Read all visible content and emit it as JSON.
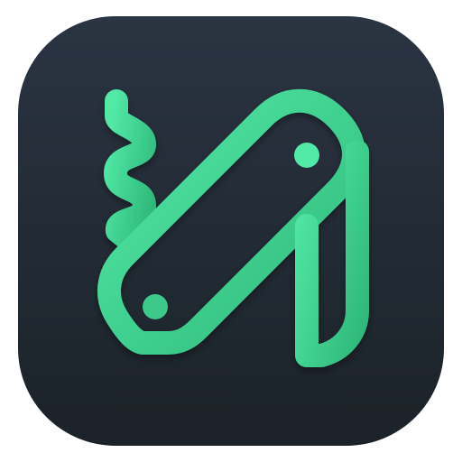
{
  "app_icon": {
    "icon": "multitool-pocket-knife-icon",
    "colors": {
      "background_top": "#2a3442",
      "background_bottom": "#1b2228",
      "accent_light": "#52e8a6",
      "accent_dark": "#2fb97a"
    }
  }
}
